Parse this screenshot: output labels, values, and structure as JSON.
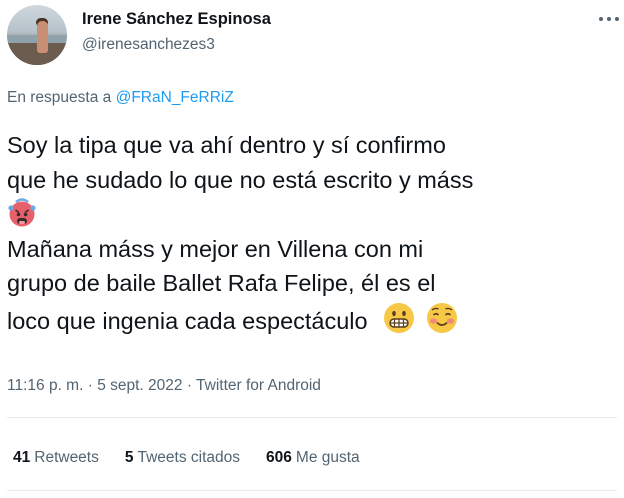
{
  "author": {
    "name": "Irene Sánchez Espinosa",
    "handle": "@irenesanchezes3"
  },
  "reply": {
    "prefix": "En respuesta a",
    "mention": "@FRaN_FeRRiZ"
  },
  "tweet": {
    "line1": "Soy la tipa que va ahí dentro y sí confirmo",
    "line2": "que he sudado lo que no está escrito y máss",
    "line4": "Mañana máss y mejor en Villena con mi",
    "line5": "grupo de baile Ballet Rafa Felipe, él es el",
    "line6": "loco que ingenia cada espectáculo",
    "emojis": [
      "hot-face-emoji",
      "grimacing-face-emoji",
      "smiling-face-emoji"
    ]
  },
  "meta": {
    "time": "11:16 p. m.",
    "sep1": " · ",
    "date": "5 sept. 2022",
    "sep2": " · ",
    "source": "Twitter for Android"
  },
  "stats": {
    "retweets_count": "41",
    "retweets_label": "Retweets",
    "quotes_count": "5",
    "quotes_label": "Tweets citados",
    "likes_count": "606",
    "likes_label": "Me gusta"
  }
}
